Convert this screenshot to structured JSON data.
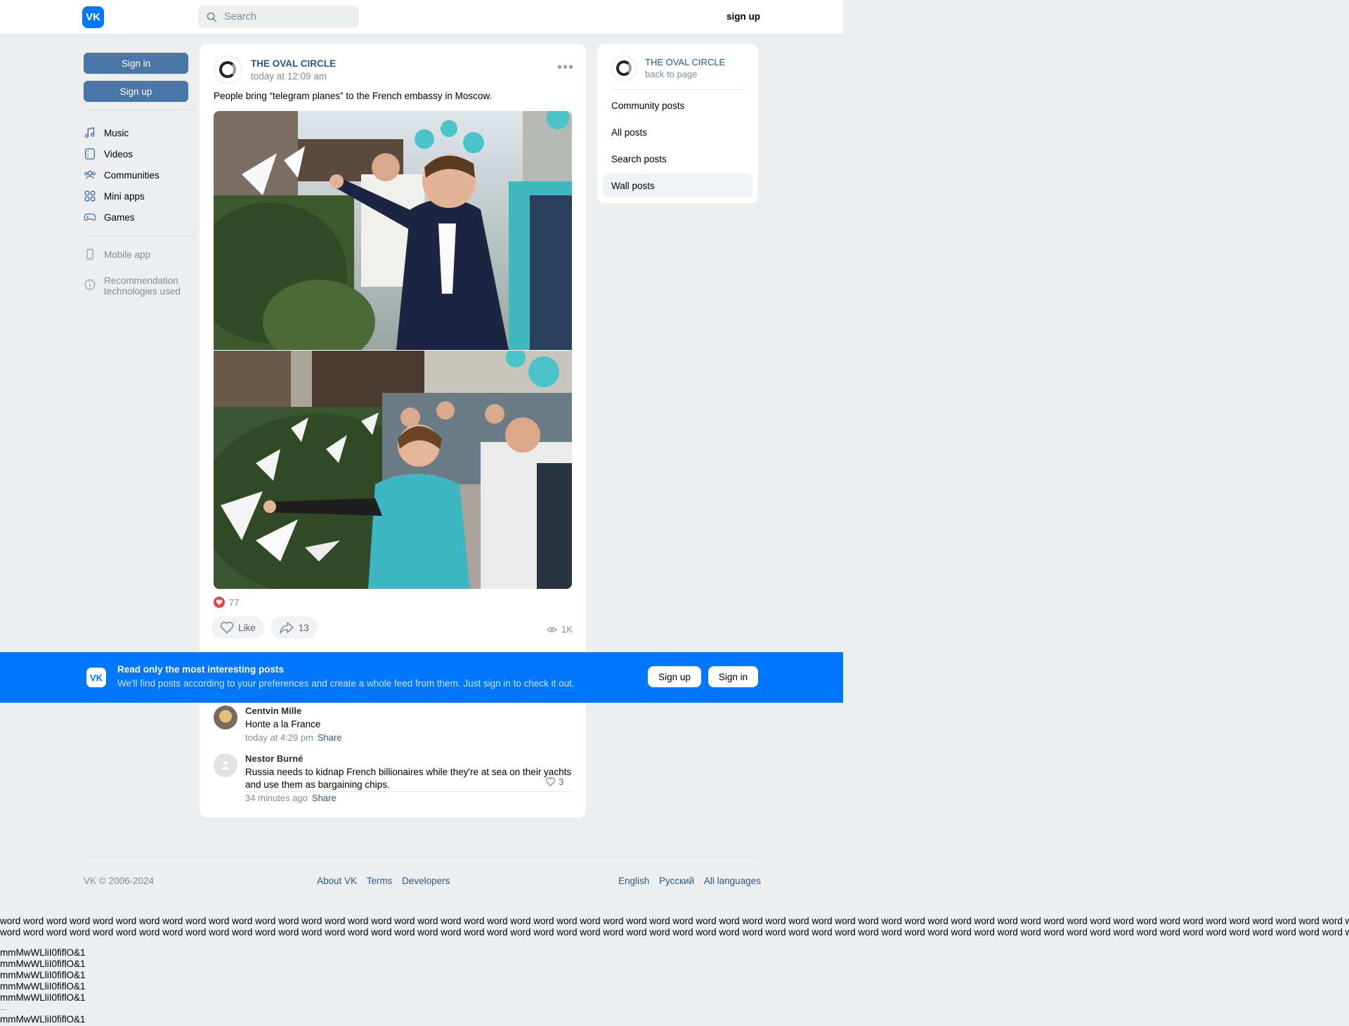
{
  "header": {
    "logo": "VK",
    "search_placeholder": "Search",
    "signup": "sign up"
  },
  "left": {
    "signin": "Sign in",
    "signup": "Sign up",
    "nav": [
      {
        "label": "Music",
        "icon": "music-icon"
      },
      {
        "label": "Videos",
        "icon": "video-icon"
      },
      {
        "label": "Communities",
        "icon": "communities-icon"
      },
      {
        "label": "Mini apps",
        "icon": "mini-apps-icon"
      },
      {
        "label": "Games",
        "icon": "gamepad-icon"
      }
    ],
    "mobile_app": "Mobile app",
    "recommendation_1": "Recommendation",
    "recommendation_2": "technologies used"
  },
  "post": {
    "author": "THE OVAL CIRCLE",
    "date": "today at 12:09 am",
    "text": "People bring “telegram planes” to the French embassy in Moscow.",
    "likes": "77",
    "like_label": "Like",
    "shares": "13",
    "views": "1K"
  },
  "comments": [
    {
      "name": "Centvin Mille",
      "text": "Honte a la France",
      "time": "today at 4:29 pm",
      "share": "Share",
      "likes": "3"
    },
    {
      "name": "Nestor Burné",
      "text_1": "Russia needs to kidnap French billionaires while they're at sea on their yachts",
      "text_2": "and use them as bargaining chips.",
      "time": "34 minutes ago",
      "share": "Share"
    }
  ],
  "right": {
    "title": "THE OVAL CIRCLE",
    "subtitle": "back to page",
    "items": [
      "Community posts",
      "All posts",
      "Search posts",
      "Wall posts"
    ]
  },
  "banner": {
    "title": "Read only the most interesting posts",
    "subtitle": "We'll find posts according to your preferences and create a whole feed from them. Just sign in to check it out.",
    "signup": "Sign up",
    "signin": "Sign in"
  },
  "footer": {
    "copyright": "VK © 2006-2024",
    "links": [
      "About VK",
      "Terms",
      "Developers"
    ],
    "langs": [
      "English",
      "Русский",
      "All languages"
    ]
  },
  "debug": {
    "words_line": "word word word word word word word word word word word word word word word word word word word word word word word word word word word word word word word word word word word word word word word word word word word word word word word word word word word word word word word word word word word word",
    "chars": "mmMwWLliI0fiflO&1",
    "dash": "—"
  },
  "colors": {
    "accent": "#0077ff",
    "button": "#4a76a8",
    "link": "#2a5885",
    "background": "#edeef0"
  }
}
